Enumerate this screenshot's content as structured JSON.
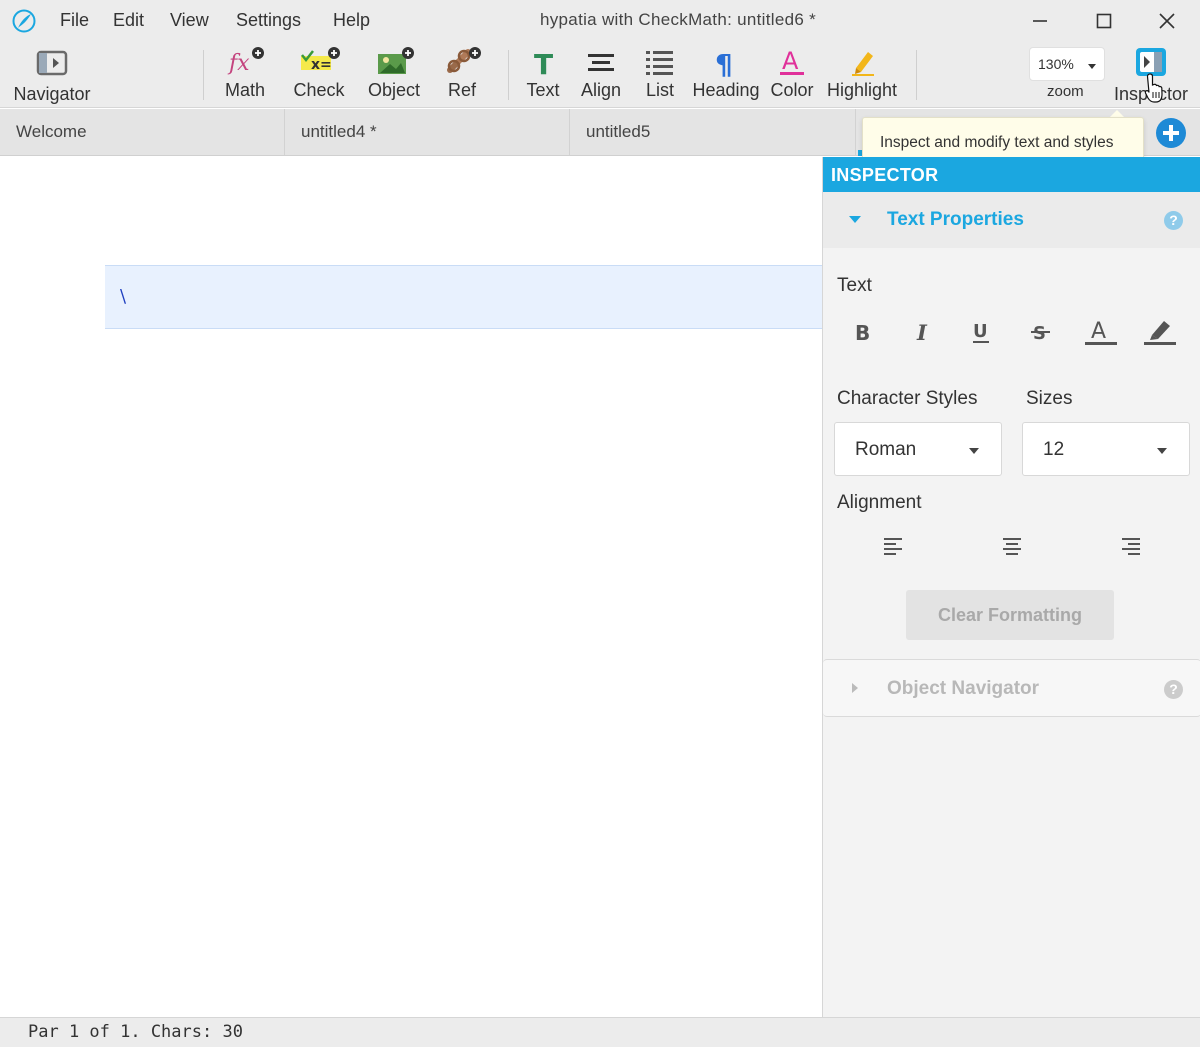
{
  "window": {
    "title": "hypatia with CheckMath: untitled6 *"
  },
  "menu": [
    "File",
    "Edit",
    "View",
    "Settings",
    "Help"
  ],
  "toolbar": {
    "navigator": "Navigator",
    "math": "Math",
    "check": "Check",
    "object": "Object",
    "ref": "Ref",
    "text": "Text",
    "align": "Align",
    "list": "List",
    "heading": "Heading",
    "color": "Color",
    "highlight": "Highlight",
    "zoom_value": "130%",
    "zoom_label": "zoom",
    "inspector": "Inspector"
  },
  "tabs": [
    {
      "label": "Welcome"
    },
    {
      "label": "untitled4 *"
    },
    {
      "label": "untitled5"
    }
  ],
  "tooltip": "Inspect and modify text and styles",
  "editor": {
    "math_content": "\\"
  },
  "inspector": {
    "title": "INSPECTOR",
    "text_properties": "Text Properties",
    "text_label": "Text",
    "character_styles_label": "Character Styles",
    "sizes_label": "Sizes",
    "character_style_value": "Roman",
    "size_value": "12",
    "alignment_label": "Alignment",
    "clear_formatting": "Clear Formatting",
    "object_navigator": "Object Navigator",
    "help_glyph": "?"
  },
  "status": "Par 1 of 1. Chars: 30",
  "colors": {
    "accent": "#1ba7e0",
    "math_block_bg": "#e8f1fe",
    "add_tab": "#1e8ad6"
  }
}
